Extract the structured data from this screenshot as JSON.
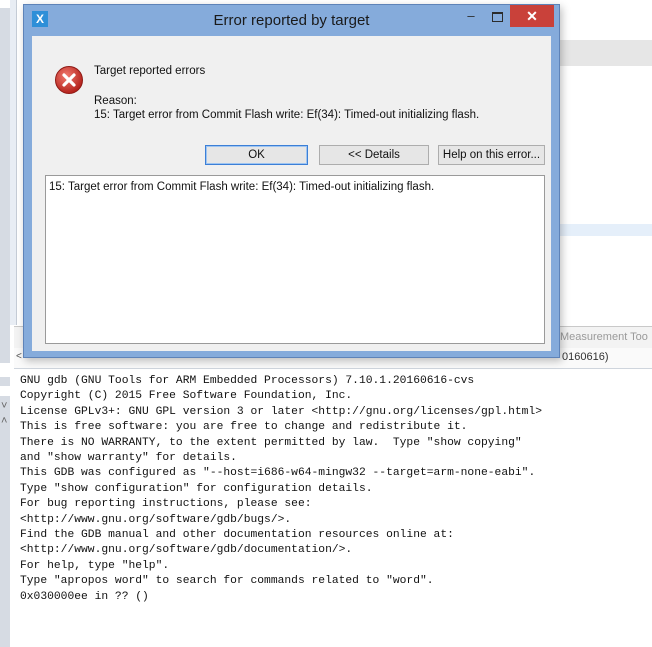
{
  "dialog": {
    "title": "Error reported by target",
    "app_icon": "X",
    "window_controls": {
      "minimize": "–",
      "maximize": "",
      "close": "✕"
    },
    "icon": "error-icon",
    "heading": "Target reported errors",
    "reason_label": "Reason:",
    "reason_text": "15: Target error from Commit Flash write: Ef(34): Timed-out initializing flash.",
    "buttons": {
      "ok": "OK",
      "details": "<< Details",
      "help": "Help on this error..."
    },
    "details_text": "15: Target error from Commit Flash write: Ef(34): Timed-out initializing flash."
  },
  "ide": {
    "console_tab_partial": "Measurement Too",
    "console_sub_partial": "0160616)",
    "console_lines": [
      "GNU gdb (GNU Tools for ARM Embedded Processors) 7.10.1.20160616-cvs",
      "Copyright (C) 2015 Free Software Foundation, Inc.",
      "License GPLv3+: GNU GPL version 3 or later <http://gnu.org/licenses/gpl.html>",
      "This is free software: you are free to change and redistribute it.",
      "There is NO WARRANTY, to the extent permitted by law.  Type \"show copying\"",
      "and \"show warranty\" for details.",
      "This GDB was configured as \"--host=i686-w64-mingw32 --target=arm-none-eabi\".",
      "Type \"show configuration\" for configuration details.",
      "For bug reporting instructions, please see:",
      "<http://www.gnu.org/software/gdb/bugs/>.",
      "Find the GDB manual and other documentation resources online at:",
      "<http://www.gnu.org/software/gdb/documentation/>.",
      "For help, type \"help\".",
      "Type \"apropos word\" to search for commands related to \"word\".",
      "0x030000ee in ?? ()"
    ]
  },
  "colors": {
    "title_bar": "#85abdb",
    "close_button": "#c9413a",
    "error_red": "#d0312d"
  }
}
